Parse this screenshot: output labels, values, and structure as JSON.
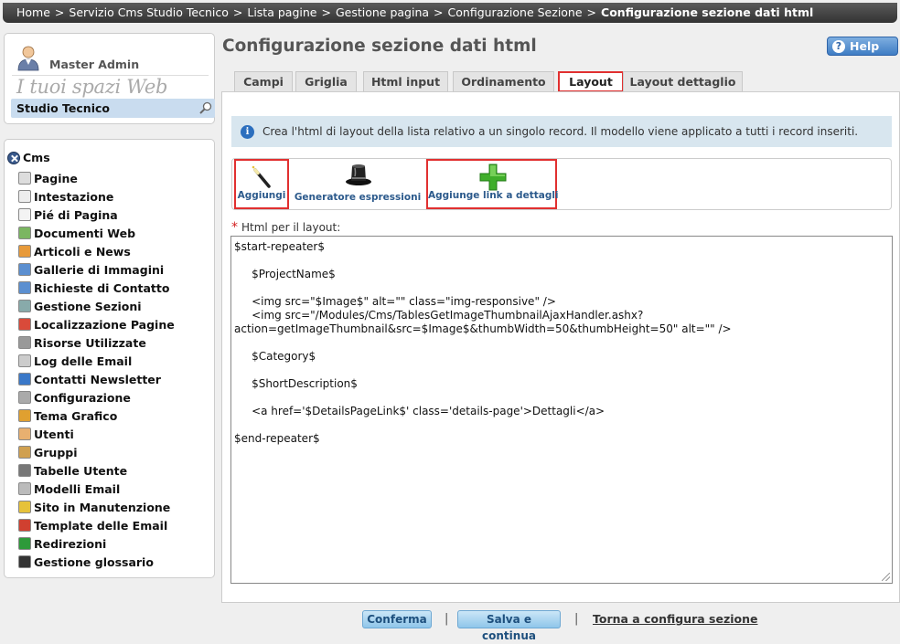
{
  "breadcrumb": {
    "items": [
      "Home",
      "Servizio Cms Studio Tecnico",
      "Lista pagine",
      "Gestione pagina",
      "Configurazione Sezione"
    ],
    "current": "Configurazione sezione dati html",
    "separator": ">"
  },
  "user": {
    "name": "Master Admin",
    "spaces_label": "I tuoi spazi Web",
    "site": "Studio Tecnico"
  },
  "nav": {
    "root": "Cms",
    "items": [
      {
        "label": "Pagine",
        "icon": "page-icon"
      },
      {
        "label": "Intestazione",
        "icon": "header-icon"
      },
      {
        "label": "Pié di Pagina",
        "icon": "footer-icon"
      },
      {
        "label": "Documenti Web",
        "icon": "web-documents-icon"
      },
      {
        "label": "Articoli e News",
        "icon": "news-icon"
      },
      {
        "label": "Gallerie di Immagini",
        "icon": "gallery-icon"
      },
      {
        "label": "Richieste di Contatto",
        "icon": "contact-request-icon"
      },
      {
        "label": "Gestione Sezioni",
        "icon": "sections-icon"
      },
      {
        "label": "Localizzazione Pagine",
        "icon": "localization-icon"
      },
      {
        "label": "Risorse Utilizzate",
        "icon": "resources-icon"
      },
      {
        "label": "Log delle Email",
        "icon": "email-log-icon"
      },
      {
        "label": "Contatti Newsletter",
        "icon": "newsletter-icon"
      },
      {
        "label": "Configurazione",
        "icon": "configuration-icon"
      },
      {
        "label": "Tema Grafico",
        "icon": "theme-icon"
      },
      {
        "label": "Utenti",
        "icon": "user-icon"
      },
      {
        "label": "Gruppi",
        "icon": "groups-icon"
      },
      {
        "label": "Tabelle Utente",
        "icon": "tables-icon"
      },
      {
        "label": "Modelli Email",
        "icon": "email-templates-icon"
      },
      {
        "label": "Sito in Manutenzione",
        "icon": "maintenance-icon"
      },
      {
        "label": "Template delle Email",
        "icon": "email-template-icon"
      },
      {
        "label": "Redirezioni",
        "icon": "redirect-icon"
      },
      {
        "label": "Gestione glossario",
        "icon": "glossary-icon"
      }
    ]
  },
  "main": {
    "title": "Configurazione sezione dati html",
    "help_label": "Help",
    "tabs": [
      {
        "label": "Campi"
      },
      {
        "label": "Griglia"
      },
      {
        "label": "Html input"
      },
      {
        "label": "Ordinamento"
      },
      {
        "label": "Layout"
      },
      {
        "label": "Layout dettaglio"
      }
    ],
    "active_tab": "Layout",
    "info_text": "Crea l'html di layout della lista relativo a un singolo record. Il modello viene applicato a tutti i record inseriti.",
    "toolbar": {
      "add": "Aggiungi",
      "expressions": "Generatore espressioni",
      "add_link": "Aggiunge link a dettagli"
    },
    "field_label": "Html per il layout:",
    "html_lines": [
      "$start-repeater$",
      "",
      "     $ProjectName$",
      "",
      "     <img src=\"$Image$\" alt=\"\" class=\"img-responsive\" />",
      "     <img src=\"/Modules/Cms/TablesGetImageThumbnailAjaxHandler.ashx?",
      "action=getImageThumbnail&src=$Image$&thumbWidth=50&thumbHeight=50\" alt=\"\" />",
      "",
      "     $Category$",
      "",
      "     $ShortDescription$",
      "",
      "     <a href='$DetailsPageLink$' class='details-page'>Dettagli</a>",
      "",
      "$end-repeater$"
    ]
  },
  "footer": {
    "confirm": "Conferma",
    "save_continue": "Salva e continua",
    "back": "Torna a configura sezione"
  },
  "colors": {
    "highlight": "#e13030",
    "info_bg": "#d8e6ef",
    "link": "#2c5a8c"
  }
}
